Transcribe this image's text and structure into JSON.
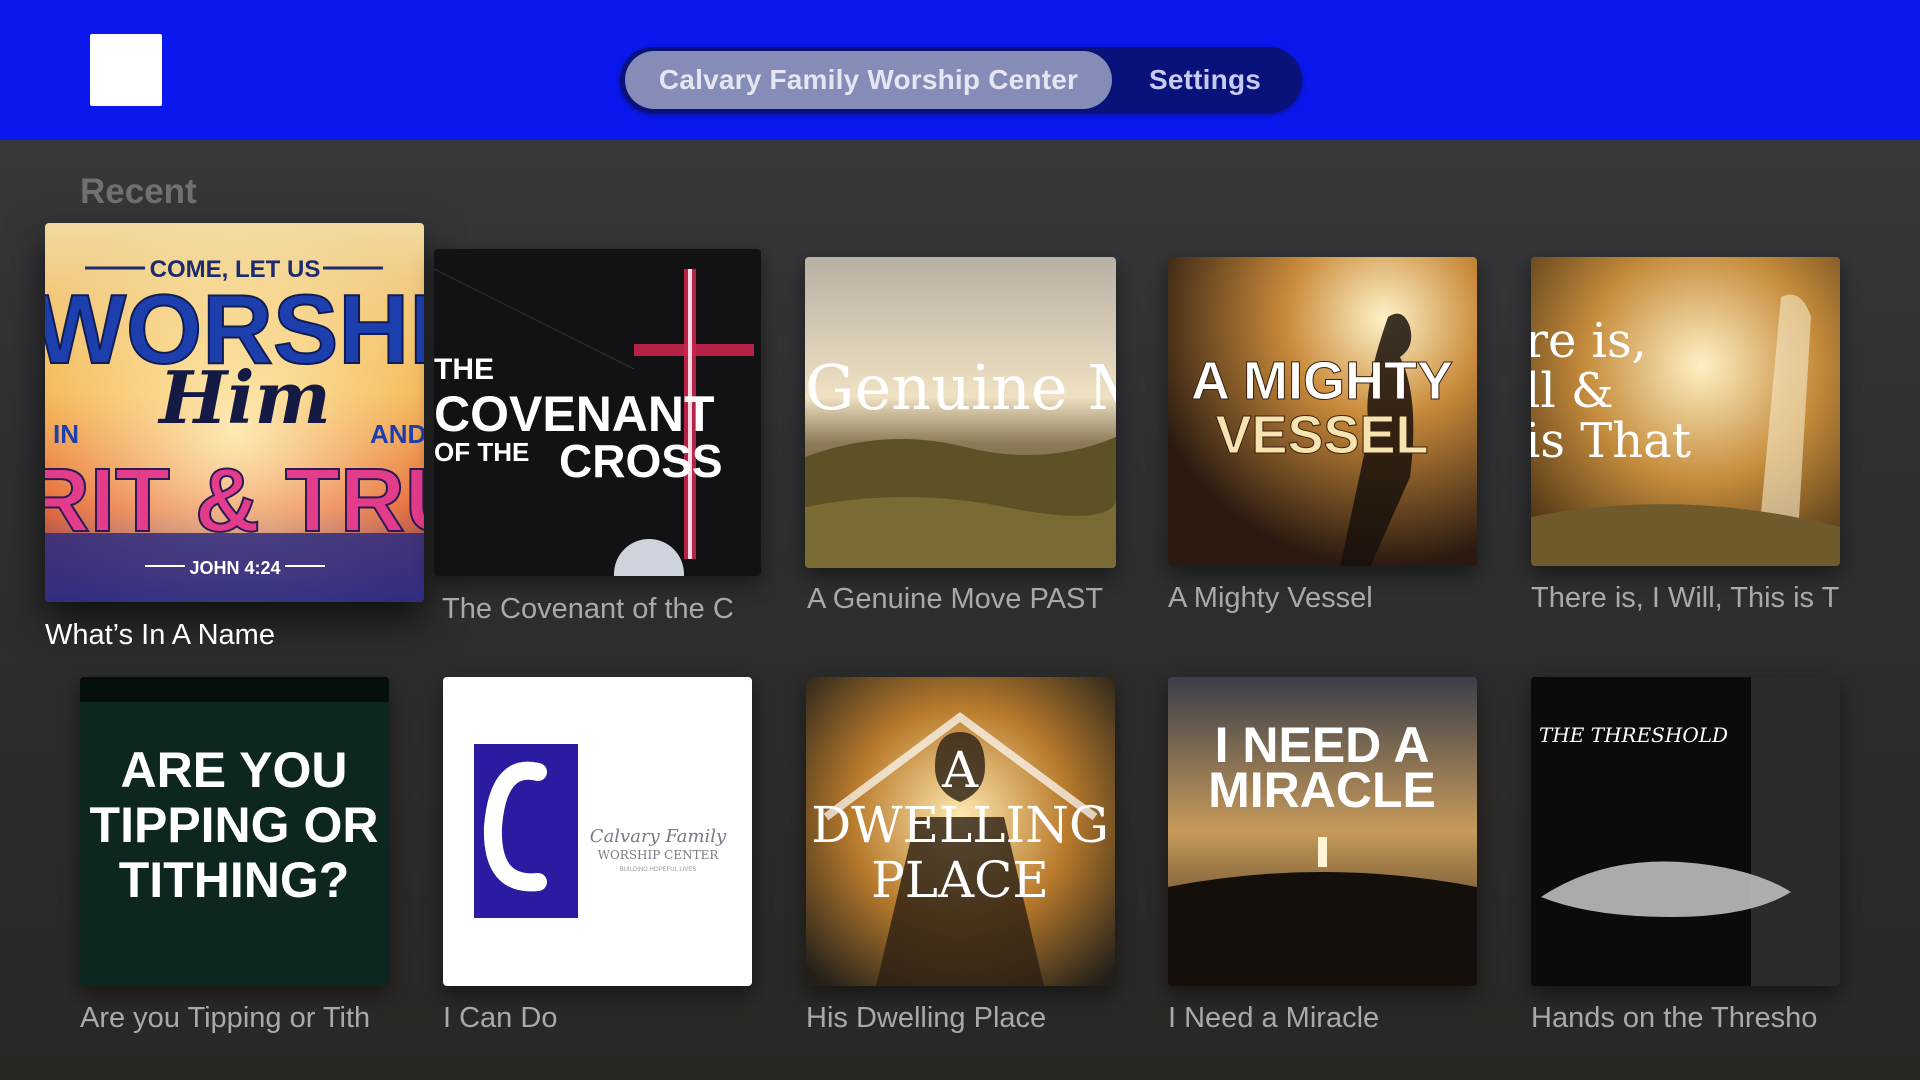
{
  "topbar": {
    "logo_icon": "app-logo-placeholder",
    "tabs": [
      {
        "label": "Calvary Family Worship Center",
        "selected": true
      },
      {
        "label": "Settings",
        "selected": false
      }
    ]
  },
  "section": {
    "title": "Recent"
  },
  "artwork": {
    "t1": {
      "top": "COME, LET US",
      "big1": "WORSHI",
      "script": "Him",
      "in": "IN",
      "and": "AND",
      "big2": "IRIT & TRU",
      "ref": "JOHN 4:24"
    },
    "t2": {
      "l1": "THE",
      "l2": "COVENANT",
      "l3": "OF THE",
      "l4": "CROSS"
    },
    "t3": {
      "l1": "Genuine Mo"
    },
    "t4": {
      "l1": "A MIGHTY",
      "l2": "VESSEL"
    },
    "t5": {
      "l1": "re is,",
      "l2": "ll &",
      "l3": "is That"
    },
    "t6": {
      "l1": "ARE YOU",
      "l2": "TIPPING OR",
      "l3": "TITHING?"
    },
    "t7": {
      "l1": "Calvary Family",
      "l2": "WORSHIP CENTER",
      "l3": "BUILDING HOPEFUL LIVES"
    },
    "t8": {
      "l1": "A",
      "l2": "DWELLING",
      "l3": "PLACE"
    },
    "t9": {
      "l1": "I NEED A",
      "l2": "MIRACLE"
    },
    "t10": {
      "l1": "THE THRESHOLD"
    }
  },
  "items": [
    {
      "title": "What’s In A Name",
      "focused": true
    },
    {
      "title": "The Covenant of the C"
    },
    {
      "title": "A Genuine Move PAST"
    },
    {
      "title": "A Mighty Vessel"
    },
    {
      "title": "There is, I Will, This is T"
    },
    {
      "title": "Are you Tipping or Tith"
    },
    {
      "title": "I Can Do"
    },
    {
      "title": "His Dwelling Place"
    },
    {
      "title": "I Need a Miracle"
    },
    {
      "title": "Hands on the Thresho"
    }
  ],
  "colors": {
    "topbar": "#0a18ee",
    "tab_active": "#858cb7",
    "tab_track": "#09117a",
    "background": "#333436"
  }
}
